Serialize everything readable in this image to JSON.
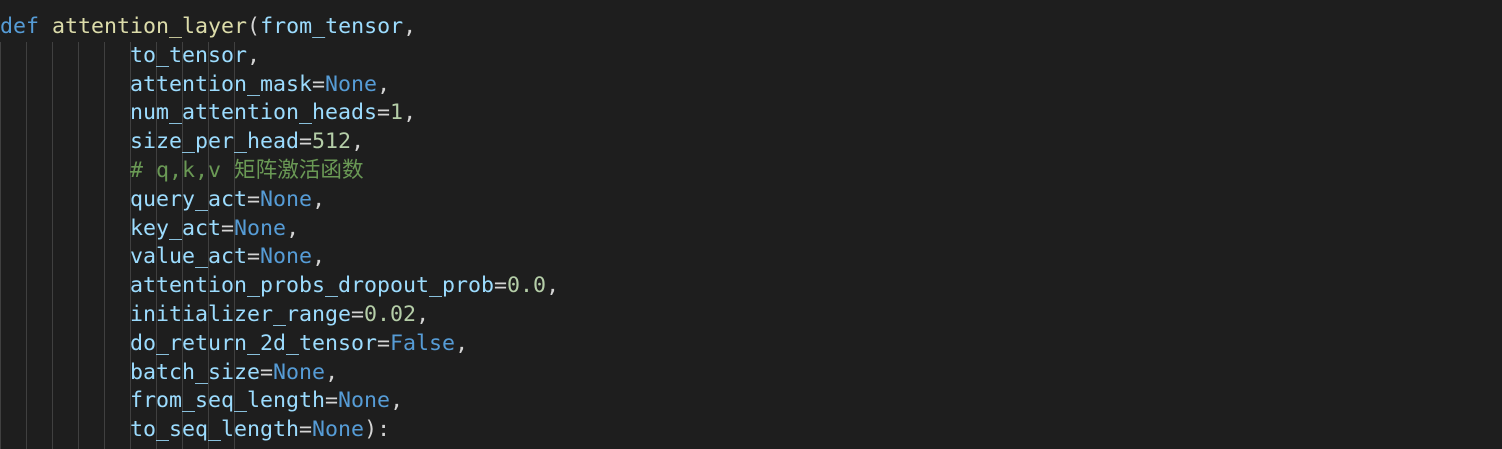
{
  "theme": {
    "background": "#1e1e1e",
    "text": "#d4d4d4",
    "keyword": "#569cd6",
    "function": "#dcdcaa",
    "parameter": "#9cdcfe",
    "number": "#b5cea8",
    "comment": "#6a9955",
    "indent_guide": "#404040"
  },
  "code": {
    "lines": [
      {
        "segments": [
          {
            "t": "def",
            "c": "kw"
          },
          {
            "t": " ",
            "c": "plain"
          },
          {
            "t": "attention_layer",
            "c": "fn"
          },
          {
            "t": "(",
            "c": "plain"
          },
          {
            "t": "from_tensor",
            "c": "param"
          },
          {
            "t": ",",
            "c": "plain"
          }
        ]
      },
      {
        "segments": [
          {
            "t": "          ",
            "c": "plain"
          },
          {
            "t": "to_tensor",
            "c": "param"
          },
          {
            "t": ",",
            "c": "plain"
          }
        ]
      },
      {
        "segments": [
          {
            "t": "          ",
            "c": "plain"
          },
          {
            "t": "attention_mask",
            "c": "param"
          },
          {
            "t": "=",
            "c": "plain"
          },
          {
            "t": "None",
            "c": "kw"
          },
          {
            "t": ",",
            "c": "plain"
          }
        ]
      },
      {
        "segments": [
          {
            "t": "          ",
            "c": "plain"
          },
          {
            "t": "num_attention_heads",
            "c": "param"
          },
          {
            "t": "=",
            "c": "plain"
          },
          {
            "t": "1",
            "c": "num"
          },
          {
            "t": ",",
            "c": "plain"
          }
        ]
      },
      {
        "segments": [
          {
            "t": "          ",
            "c": "plain"
          },
          {
            "t": "size_per_head",
            "c": "param"
          },
          {
            "t": "=",
            "c": "plain"
          },
          {
            "t": "512",
            "c": "num"
          },
          {
            "t": ",",
            "c": "plain"
          }
        ]
      },
      {
        "segments": [
          {
            "t": "          ",
            "c": "plain"
          },
          {
            "t": "# q,k,v 矩阵激活函数",
            "c": "cmt"
          }
        ]
      },
      {
        "segments": [
          {
            "t": "          ",
            "c": "plain"
          },
          {
            "t": "query_act",
            "c": "param"
          },
          {
            "t": "=",
            "c": "plain"
          },
          {
            "t": "None",
            "c": "kw"
          },
          {
            "t": ",",
            "c": "plain"
          }
        ]
      },
      {
        "segments": [
          {
            "t": "          ",
            "c": "plain"
          },
          {
            "t": "key_act",
            "c": "param"
          },
          {
            "t": "=",
            "c": "plain"
          },
          {
            "t": "None",
            "c": "kw"
          },
          {
            "t": ",",
            "c": "plain"
          }
        ]
      },
      {
        "segments": [
          {
            "t": "          ",
            "c": "plain"
          },
          {
            "t": "value_act",
            "c": "param"
          },
          {
            "t": "=",
            "c": "plain"
          },
          {
            "t": "None",
            "c": "kw"
          },
          {
            "t": ",",
            "c": "plain"
          }
        ]
      },
      {
        "segments": [
          {
            "t": "          ",
            "c": "plain"
          },
          {
            "t": "attention_probs_dropout_prob",
            "c": "param"
          },
          {
            "t": "=",
            "c": "plain"
          },
          {
            "t": "0.0",
            "c": "num"
          },
          {
            "t": ",",
            "c": "plain"
          }
        ]
      },
      {
        "segments": [
          {
            "t": "          ",
            "c": "plain"
          },
          {
            "t": "initializer_range",
            "c": "param"
          },
          {
            "t": "=",
            "c": "plain"
          },
          {
            "t": "0.02",
            "c": "num"
          },
          {
            "t": ",",
            "c": "plain"
          }
        ]
      },
      {
        "segments": [
          {
            "t": "          ",
            "c": "plain"
          },
          {
            "t": "do_return_2d_tensor",
            "c": "param"
          },
          {
            "t": "=",
            "c": "plain"
          },
          {
            "t": "False",
            "c": "kw"
          },
          {
            "t": ",",
            "c": "plain"
          }
        ]
      },
      {
        "segments": [
          {
            "t": "          ",
            "c": "plain"
          },
          {
            "t": "batch_size",
            "c": "param"
          },
          {
            "t": "=",
            "c": "plain"
          },
          {
            "t": "None",
            "c": "kw"
          },
          {
            "t": ",",
            "c": "plain"
          }
        ]
      },
      {
        "segments": [
          {
            "t": "          ",
            "c": "plain"
          },
          {
            "t": "from_seq_length",
            "c": "param"
          },
          {
            "t": "=",
            "c": "plain"
          },
          {
            "t": "None",
            "c": "kw"
          },
          {
            "t": ",",
            "c": "plain"
          }
        ]
      },
      {
        "segments": [
          {
            "t": "          ",
            "c": "plain"
          },
          {
            "t": "to_seq_length",
            "c": "param"
          },
          {
            "t": "=",
            "c": "plain"
          },
          {
            "t": "None",
            "c": "kw"
          },
          {
            "t": "):",
            "c": "plain"
          }
        ]
      }
    ]
  }
}
